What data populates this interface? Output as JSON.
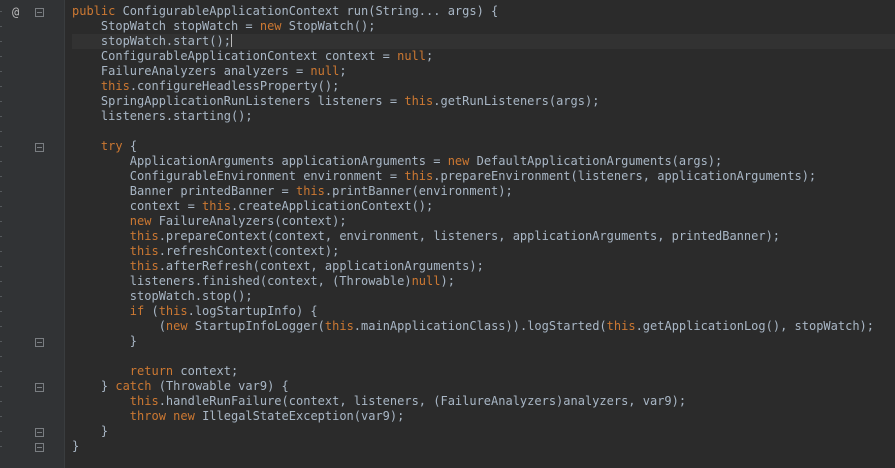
{
  "colors": {
    "background": "#2b2b2b",
    "gutter": "#313335",
    "text": "#a9b7c6",
    "keyword": "#cc7832"
  },
  "gutter": {
    "annotation_icon": "@",
    "fold_icons": [
      "fold-method",
      "fold-try",
      "fold-if-end",
      "fold-catch",
      "fold-catch-end",
      "fold-method-end"
    ]
  },
  "editor": {
    "lines": [
      [
        {
          "t": "public",
          "k": 1
        },
        {
          "t": " ConfigurableApplicationContext run(String... args) {"
        }
      ],
      [
        {
          "t": "    StopWatch stopWatch = "
        },
        {
          "t": "new",
          "k": 1
        },
        {
          "t": " StopWatch();"
        }
      ],
      [
        {
          "t": "    stopWatch.start();"
        }
      ],
      [
        {
          "t": "    ConfigurableApplicationContext context = "
        },
        {
          "t": "null",
          "k": 1
        },
        {
          "t": ";"
        }
      ],
      [
        {
          "t": "    FailureAnalyzers analyzers = "
        },
        {
          "t": "null",
          "k": 1
        },
        {
          "t": ";"
        }
      ],
      [
        {
          "t": "    "
        },
        {
          "t": "this",
          "k": 1
        },
        {
          "t": ".configureHeadlessProperty();"
        }
      ],
      [
        {
          "t": "    SpringApplicationRunListeners listeners = "
        },
        {
          "t": "this",
          "k": 1
        },
        {
          "t": ".getRunListeners(args);"
        }
      ],
      [
        {
          "t": "    listeners.starting();"
        }
      ],
      [],
      [
        {
          "t": "    "
        },
        {
          "t": "try",
          "k": 1
        },
        {
          "t": " {"
        }
      ],
      [
        {
          "t": "        ApplicationArguments applicationArguments = "
        },
        {
          "t": "new",
          "k": 1
        },
        {
          "t": " DefaultApplicationArguments(args);"
        }
      ],
      [
        {
          "t": "        ConfigurableEnvironment environment = "
        },
        {
          "t": "this",
          "k": 1
        },
        {
          "t": ".prepareEnvironment(listeners, applicationArguments);"
        }
      ],
      [
        {
          "t": "        Banner printedBanner = "
        },
        {
          "t": "this",
          "k": 1
        },
        {
          "t": ".printBanner(environment);"
        }
      ],
      [
        {
          "t": "        context = "
        },
        {
          "t": "this",
          "k": 1
        },
        {
          "t": ".createApplicationContext();"
        }
      ],
      [
        {
          "t": "        "
        },
        {
          "t": "new",
          "k": 1
        },
        {
          "t": " FailureAnalyzers(context);"
        }
      ],
      [
        {
          "t": "        "
        },
        {
          "t": "this",
          "k": 1
        },
        {
          "t": ".prepareContext(context, environment, listeners, applicationArguments, printedBanner);"
        }
      ],
      [
        {
          "t": "        "
        },
        {
          "t": "this",
          "k": 1
        },
        {
          "t": ".refreshContext(context);"
        }
      ],
      [
        {
          "t": "        "
        },
        {
          "t": "this",
          "k": 1
        },
        {
          "t": ".afterRefresh(context, applicationArguments);"
        }
      ],
      [
        {
          "t": "        listeners.finished(context, (Throwable)"
        },
        {
          "t": "null",
          "k": 1
        },
        {
          "t": ");"
        }
      ],
      [
        {
          "t": "        stopWatch.stop();"
        }
      ],
      [
        {
          "t": "        "
        },
        {
          "t": "if",
          "k": 1
        },
        {
          "t": " ("
        },
        {
          "t": "this",
          "k": 1
        },
        {
          "t": ".logStartupInfo) {"
        }
      ],
      [
        {
          "t": "            ("
        },
        {
          "t": "new",
          "k": 1
        },
        {
          "t": " StartupInfoLogger("
        },
        {
          "t": "this",
          "k": 1
        },
        {
          "t": ".mainApplicationClass)).logStarted("
        },
        {
          "t": "this",
          "k": 1
        },
        {
          "t": ".getApplicationLog(), stopWatch);"
        }
      ],
      [
        {
          "t": "        }"
        }
      ],
      [],
      [
        {
          "t": "        "
        },
        {
          "t": "return",
          "k": 1
        },
        {
          "t": " context;"
        }
      ],
      [
        {
          "t": "    } "
        },
        {
          "t": "catch",
          "k": 1
        },
        {
          "t": " (Throwable var9) {"
        }
      ],
      [
        {
          "t": "        "
        },
        {
          "t": "this",
          "k": 1
        },
        {
          "t": ".handleRunFailure(context, listeners, (FailureAnalyzers)analyzers, var9);"
        }
      ],
      [
        {
          "t": "        "
        },
        {
          "t": "throw",
          "k": 1
        },
        {
          "t": " "
        },
        {
          "t": "new",
          "k": 1
        },
        {
          "t": " IllegalStateException(var9);"
        }
      ],
      [
        {
          "t": "    }"
        }
      ],
      [
        {
          "t": "}"
        }
      ]
    ]
  }
}
